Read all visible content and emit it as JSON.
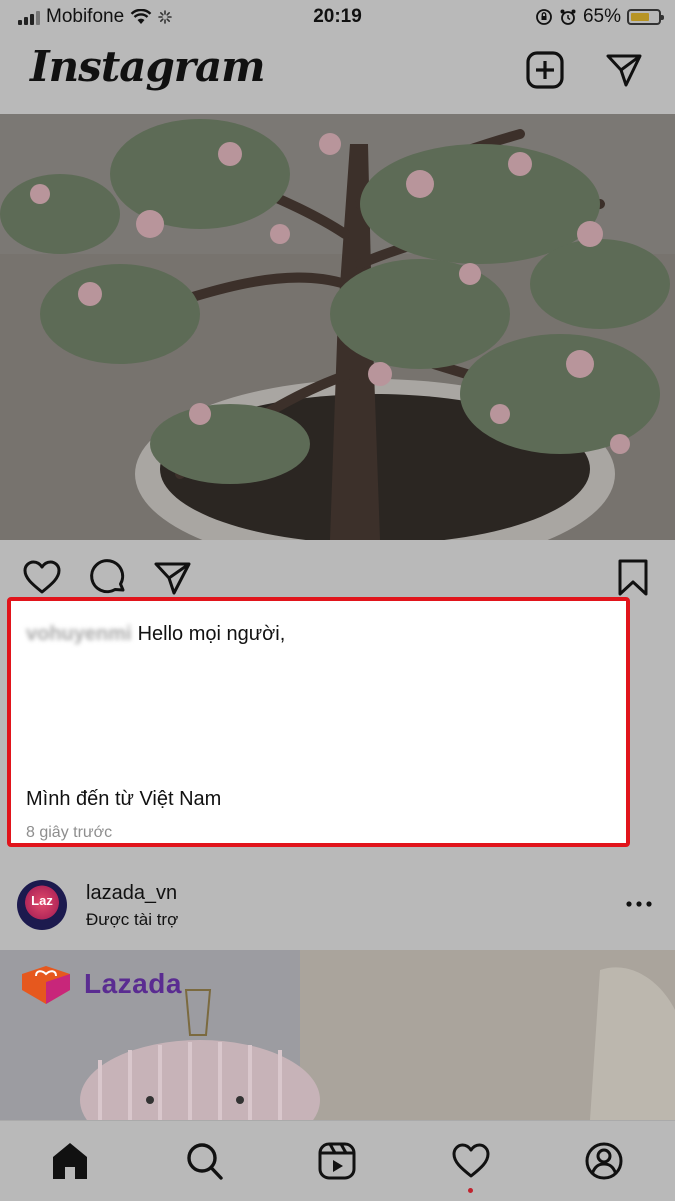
{
  "status_bar": {
    "carrier": "Mobifone",
    "time": "20:19",
    "battery_percent": "65%",
    "battery_level": 0.65
  },
  "header": {
    "logo_text": "Instagram",
    "icons": [
      "new-post-icon",
      "direct-message-icon"
    ]
  },
  "post": {
    "actions": [
      "like-icon",
      "comment-icon",
      "share-icon",
      "bookmark-icon"
    ],
    "caption": {
      "username": "vohuyenmi",
      "text_line1": "Hello mọi người,",
      "text_line2": "Mình đến từ Việt Nam",
      "timestamp": "8 giây trước"
    },
    "highlight_color": "#e1141b"
  },
  "sponsored_post": {
    "avatar_label": "Laz",
    "username": "lazada_vn",
    "subtitle": "Được tài trợ",
    "ad_brand": "Lazada"
  },
  "tab_bar": {
    "tabs": [
      "home-icon",
      "search-icon",
      "reels-icon",
      "activity-icon",
      "profile-icon"
    ],
    "active": "home-icon",
    "notification_dot_color": "#c0232e"
  }
}
